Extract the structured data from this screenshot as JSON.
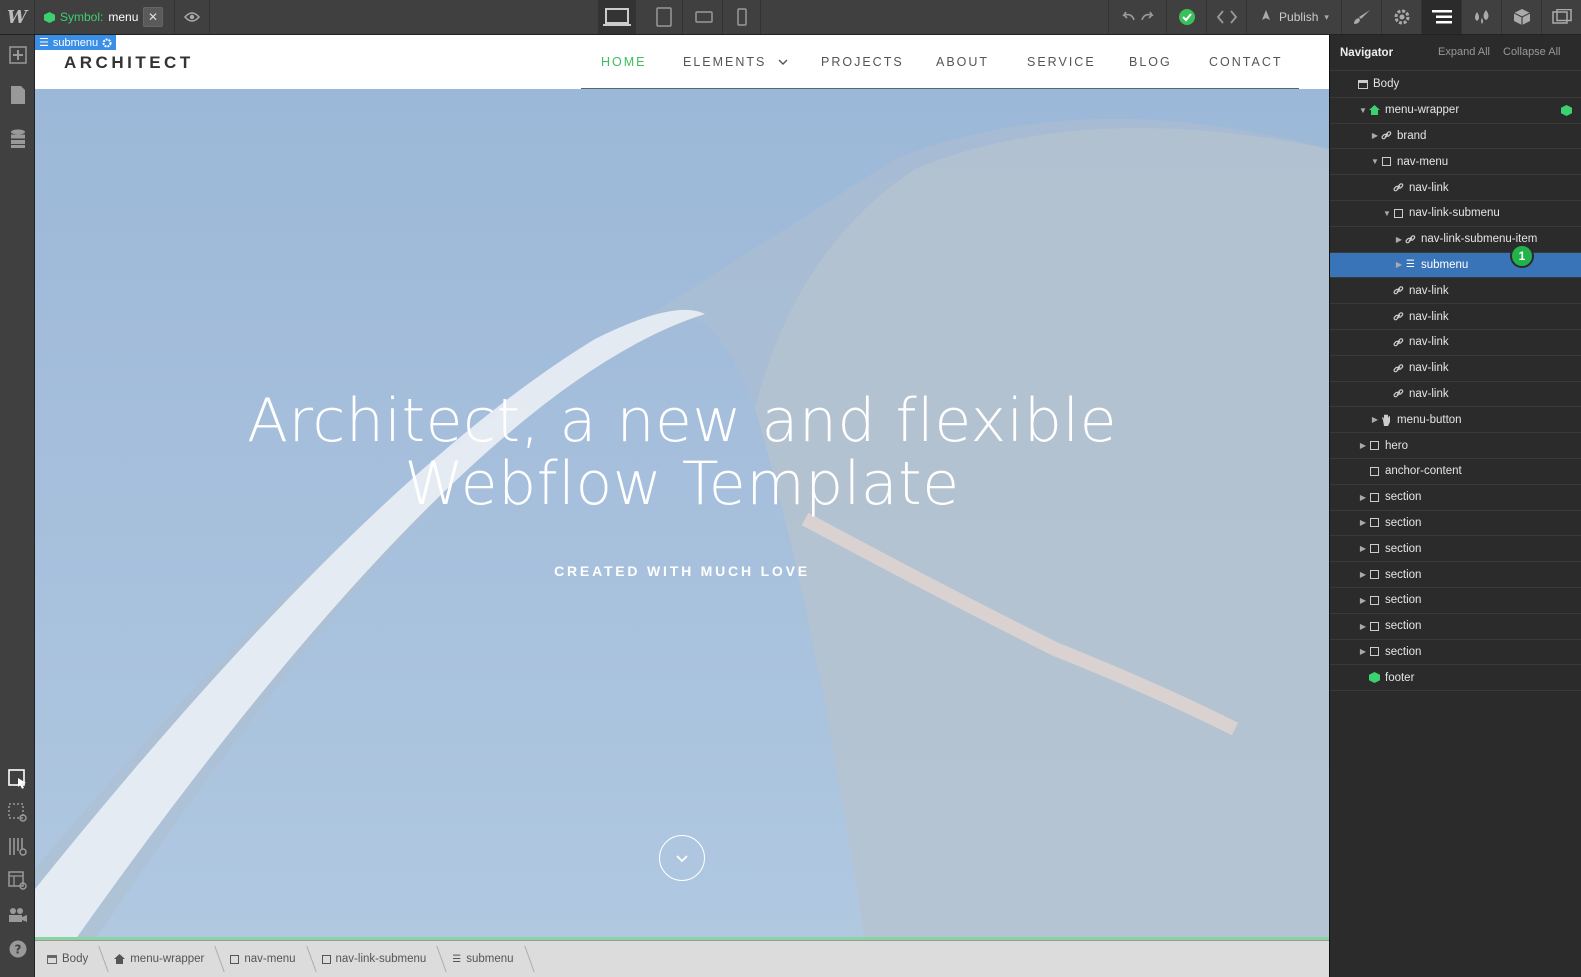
{
  "app": {
    "logo": "W",
    "symbol_label": "Symbol:",
    "symbol_name": "menu",
    "close_glyph": "✕",
    "publish_label": "Publish"
  },
  "selection_tag": "submenu",
  "site": {
    "brand": "ARCHITECT",
    "nav_links": [
      "HOME",
      "ELEMENTS",
      "PROJECTS",
      "ABOUT",
      "SERVICE",
      "BLOG",
      "CONTACT"
    ],
    "hero_title_line1": "Architect, a new and flexible",
    "hero_title_line2": "Webflow Template",
    "hero_subtitle": "CREATED WITH MUCH LOVE"
  },
  "navigator": {
    "title": "Navigator",
    "expand_all": "Expand All",
    "collapse_all": "Collapse All",
    "badge": "1",
    "nodes": [
      {
        "label": "Body",
        "icon": "body-icon",
        "depth": 0,
        "arrow": ""
      },
      {
        "label": "menu-wrapper",
        "icon": "home-icon",
        "depth": 1,
        "arrow": "down"
      },
      {
        "label": "brand",
        "icon": "link-icon",
        "depth": 2,
        "arrow": "right"
      },
      {
        "label": "nav-menu",
        "icon": "box-icon",
        "depth": 2,
        "arrow": "down"
      },
      {
        "label": "nav-link",
        "icon": "link-icon",
        "depth": 3,
        "arrow": ""
      },
      {
        "label": "nav-link-submenu",
        "icon": "box-icon",
        "depth": 3,
        "arrow": "down"
      },
      {
        "label": "nav-link-submenu-item",
        "icon": "link-icon",
        "depth": 4,
        "arrow": "right"
      },
      {
        "label": "submenu",
        "icon": "list-icon",
        "depth": 4,
        "arrow": "right"
      },
      {
        "label": "nav-link",
        "icon": "link-icon",
        "depth": 3,
        "arrow": ""
      },
      {
        "label": "nav-link",
        "icon": "link-icon",
        "depth": 3,
        "arrow": ""
      },
      {
        "label": "nav-link",
        "icon": "link-icon",
        "depth": 3,
        "arrow": ""
      },
      {
        "label": "nav-link",
        "icon": "link-icon",
        "depth": 3,
        "arrow": ""
      },
      {
        "label": "nav-link",
        "icon": "link-icon",
        "depth": 3,
        "arrow": ""
      },
      {
        "label": "menu-button",
        "icon": "hand-icon",
        "depth": 2,
        "arrow": "right"
      },
      {
        "label": "hero",
        "icon": "box-icon",
        "depth": 1,
        "arrow": "right"
      },
      {
        "label": "anchor-content",
        "icon": "box-icon",
        "depth": 1,
        "arrow": ""
      },
      {
        "label": "section",
        "icon": "box-icon",
        "depth": 1,
        "arrow": "right"
      },
      {
        "label": "section",
        "icon": "box-icon",
        "depth": 1,
        "arrow": "right"
      },
      {
        "label": "section",
        "icon": "box-icon",
        "depth": 1,
        "arrow": "right"
      },
      {
        "label": "section",
        "icon": "box-icon",
        "depth": 1,
        "arrow": "right"
      },
      {
        "label": "section",
        "icon": "box-icon",
        "depth": 1,
        "arrow": "right"
      },
      {
        "label": "section",
        "icon": "box-icon",
        "depth": 1,
        "arrow": "right"
      },
      {
        "label": "section",
        "icon": "box-icon",
        "depth": 1,
        "arrow": "right"
      },
      {
        "label": "footer",
        "icon": "symbol-icon",
        "depth": 1,
        "arrow": ""
      }
    ],
    "selected_index": 7
  },
  "breadcrumb": [
    {
      "label": "Body",
      "icon": "body-icon"
    },
    {
      "label": "menu-wrapper",
      "icon": "home-icon"
    },
    {
      "label": "nav-menu",
      "icon": "box-icon"
    },
    {
      "label": "nav-link-submenu",
      "icon": "box-icon"
    },
    {
      "label": "submenu",
      "icon": "list-icon"
    }
  ],
  "colors": {
    "accent_green": "#3bbf5b",
    "selection_blue": "#3a74b8"
  }
}
